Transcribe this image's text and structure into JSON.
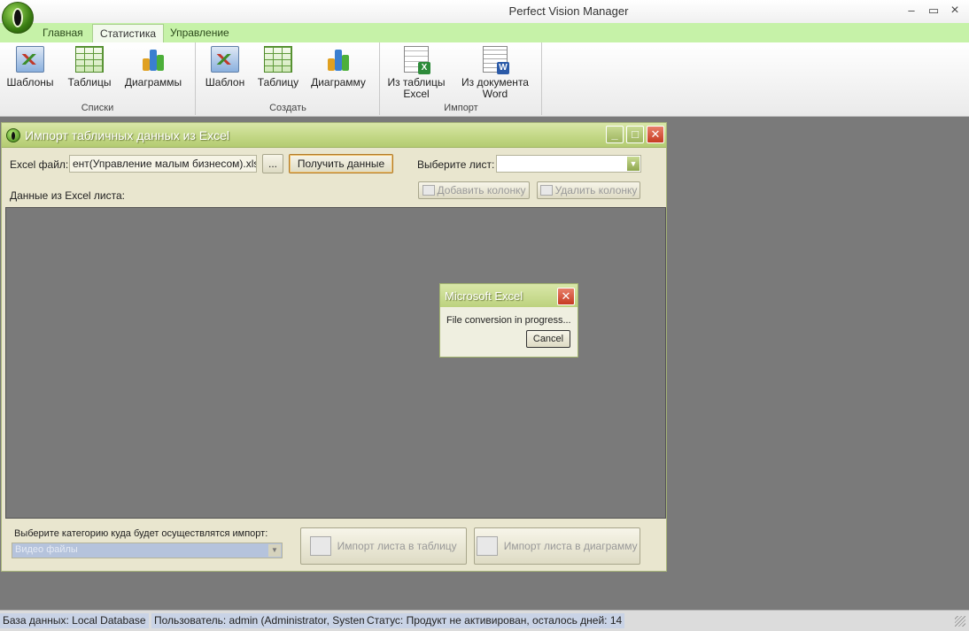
{
  "app": {
    "title": "Perfect Vision Manager"
  },
  "window_controls": {
    "minimize": "–",
    "maximize": "▭",
    "close": "×"
  },
  "tabs": [
    {
      "label": "Главная",
      "active": false
    },
    {
      "label": "Статистика",
      "active": true
    },
    {
      "label": "Управление",
      "active": false
    }
  ],
  "ribbon": {
    "groups": [
      {
        "label": "Списки",
        "buttons": [
          "Шаблоны",
          "Таблицы",
          "Диаграммы"
        ]
      },
      {
        "label": "Создать",
        "buttons": [
          "Шаблон",
          "Таблицу",
          "Диаграмму"
        ]
      },
      {
        "label": "Импорт",
        "buttons": [
          "Из таблицы\nExcel",
          "Из документа\nWord"
        ]
      }
    ]
  },
  "import_window": {
    "title": "Импорт табличных данных из Excel",
    "excel_file_label": "Excel файл:",
    "excel_file_value": "ент(Управление малым бизнесом).xlsx",
    "browse_label": "...",
    "get_data_label": "Получить данные",
    "sheet_label": "Выберите лист:",
    "sheet_value": "",
    "add_column_label": "Добавить колонку",
    "delete_column_label": "Удалить колонку",
    "data_label": "Данные из Excel листа:",
    "category_label": "Выберите категорию куда будет осуществлятся импорт:",
    "category_value": "Видео файлы",
    "import_table_label": "Импорт листа в таблицу",
    "import_chart_label": "Импорт листа в диаграмму"
  },
  "dialog": {
    "title": "Microsoft Excel",
    "message": "File conversion in progress...",
    "cancel_label": "Cancel"
  },
  "statusbar": {
    "database": "База данных: Local Database",
    "user": "Пользователь: admin (Administrator, System).",
    "status": "Статус: Продукт не активирован, осталось дней: 14"
  },
  "colors": {
    "tab_strip": "#c6f2a8",
    "window_title_gradient": "#c3d886",
    "workspace": "#7a7a7a",
    "close_button": "#c63a22"
  }
}
